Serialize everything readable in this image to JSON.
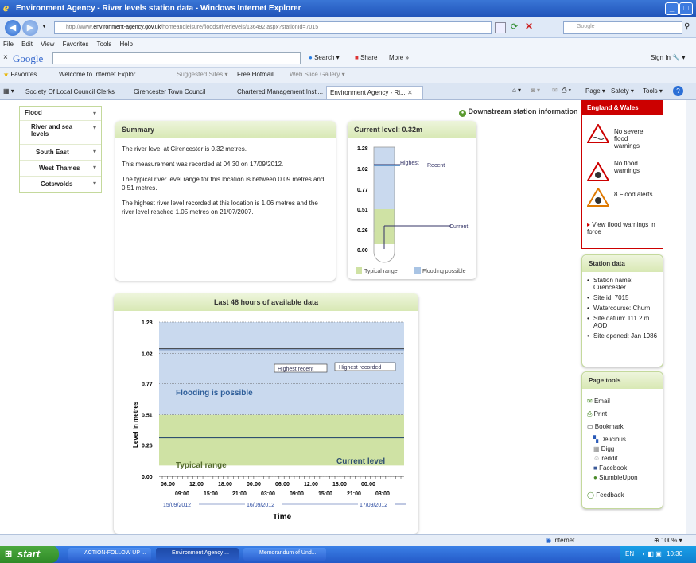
{
  "window": {
    "title": "Environment Agency - River levels station data - Windows Internet Explorer"
  },
  "address": {
    "url_prefix": "http://www.",
    "url_domain": "environment-agency.gov.uk",
    "url_rest": "/homeandleisure/floods/riverlevels/136492.aspx?stationId=7015",
    "search_placeholder": "Google"
  },
  "menu": [
    "File",
    "Edit",
    "View",
    "Favorites",
    "Tools",
    "Help"
  ],
  "google_toolbar": {
    "logo": "Google",
    "search": "Search",
    "share": "Share",
    "more": "More »",
    "sign_in": "Sign In"
  },
  "favorites": {
    "label": "Favorites",
    "items": [
      "Welcome to Internet Explor...",
      "Suggested Sites ▾",
      "Free Hotmail",
      "Web Slice Gallery ▾"
    ]
  },
  "tabs": [
    "Society Of Local Council Clerks",
    "Cirencester Town Council",
    "Chartered Management Insti...",
    "Environment Agency - Ri..."
  ],
  "command_bar": [
    "Page ▾",
    "Safety ▾",
    "Tools ▾"
  ],
  "left_nav": [
    "Flood",
    "River and sea levels",
    "South East",
    "West Thames",
    "Cotswolds"
  ],
  "downstream_link": "Downstream station information",
  "summary": {
    "title": "Summary",
    "paragraphs": [
      "The river level at Cirencester is 0.32 metres.",
      "This measurement was recorded at 04:30 on 17/09/2012.",
      "The typical river level range for this location is between 0.09 metres and 0.51 metres.",
      "The highest river level recorded at this location is 1.06 metres and the river level reached 1.05 metres on 21/07/2007."
    ]
  },
  "gauge": {
    "title": "Current level: 0.32m",
    "ticks": [
      "1.28",
      "1.02",
      "0.77",
      "0.51",
      "0.26",
      "0.00"
    ],
    "labels": {
      "highest": "Highest",
      "recent": "Recent",
      "current": "Current"
    },
    "legend_typical": "Typical range",
    "legend_flooding": "Flooding possible",
    "current_level": 0.32,
    "typical_range": [
      0.09,
      0.51
    ],
    "highest": 1.06,
    "recent_high": 1.05
  },
  "chart_data": {
    "type": "line",
    "title": "Last 48 hours of available data",
    "xlabel": "Time",
    "ylabel": "Level in metres",
    "y_ticks": [
      "1.28",
      "1.02",
      "0.77",
      "0.51",
      "0.26",
      "0.00"
    ],
    "ylim": [
      0,
      1.28
    ],
    "x_ticks_top": [
      "06:00",
      "12:00",
      "18:00",
      "00:00",
      "06:00",
      "12:00",
      "18:00",
      "00:00"
    ],
    "x_ticks_bottom": [
      "09:00",
      "15:00",
      "21:00",
      "03:00",
      "09:00",
      "15:00",
      "21:00",
      "03:00"
    ],
    "dates": [
      "15/09/2012",
      "16/09/2012",
      "17/09/2012"
    ],
    "annotations": {
      "flooding": "Flooding is possible",
      "typical": "Typical range",
      "current": "Current level",
      "highest_recent": "Highest recent",
      "highest_recorded": "Highest recorded"
    },
    "series": [
      {
        "values": [
          0.32,
          0.32
        ]
      }
    ],
    "highest_recent": 1.05,
    "highest_recorded": 1.06,
    "typical_range": [
      0.09,
      0.51
    ]
  },
  "warnings": {
    "region": "England & Wales",
    "items": [
      "No severe flood warnings",
      "No flood warnings",
      "8 Flood alerts"
    ],
    "link": "View flood warnings in force"
  },
  "station": {
    "title": "Station data",
    "items": [
      "Station name: Cirencester",
      "Site id: 7015",
      "Watercourse: Churn",
      "Site datum: 111.2 m AOD",
      "Site opened: Jan 1986"
    ]
  },
  "page_tools": {
    "title": "Page tools",
    "email": "Email",
    "print": "Print",
    "bookmark": "Bookmark",
    "social": [
      "Delicious",
      "Digg",
      "reddit",
      "Facebook",
      "StumbleUpon"
    ],
    "feedback": "Feedback"
  },
  "status": {
    "zone": "Internet",
    "zoom": "100%"
  },
  "taskbar": {
    "start": "start",
    "items": [
      "ACTION-FOLLOW UP ...",
      "Environment Agency ...",
      "Memorandum of Und..."
    ],
    "lang": "EN",
    "clock": "10:30"
  }
}
